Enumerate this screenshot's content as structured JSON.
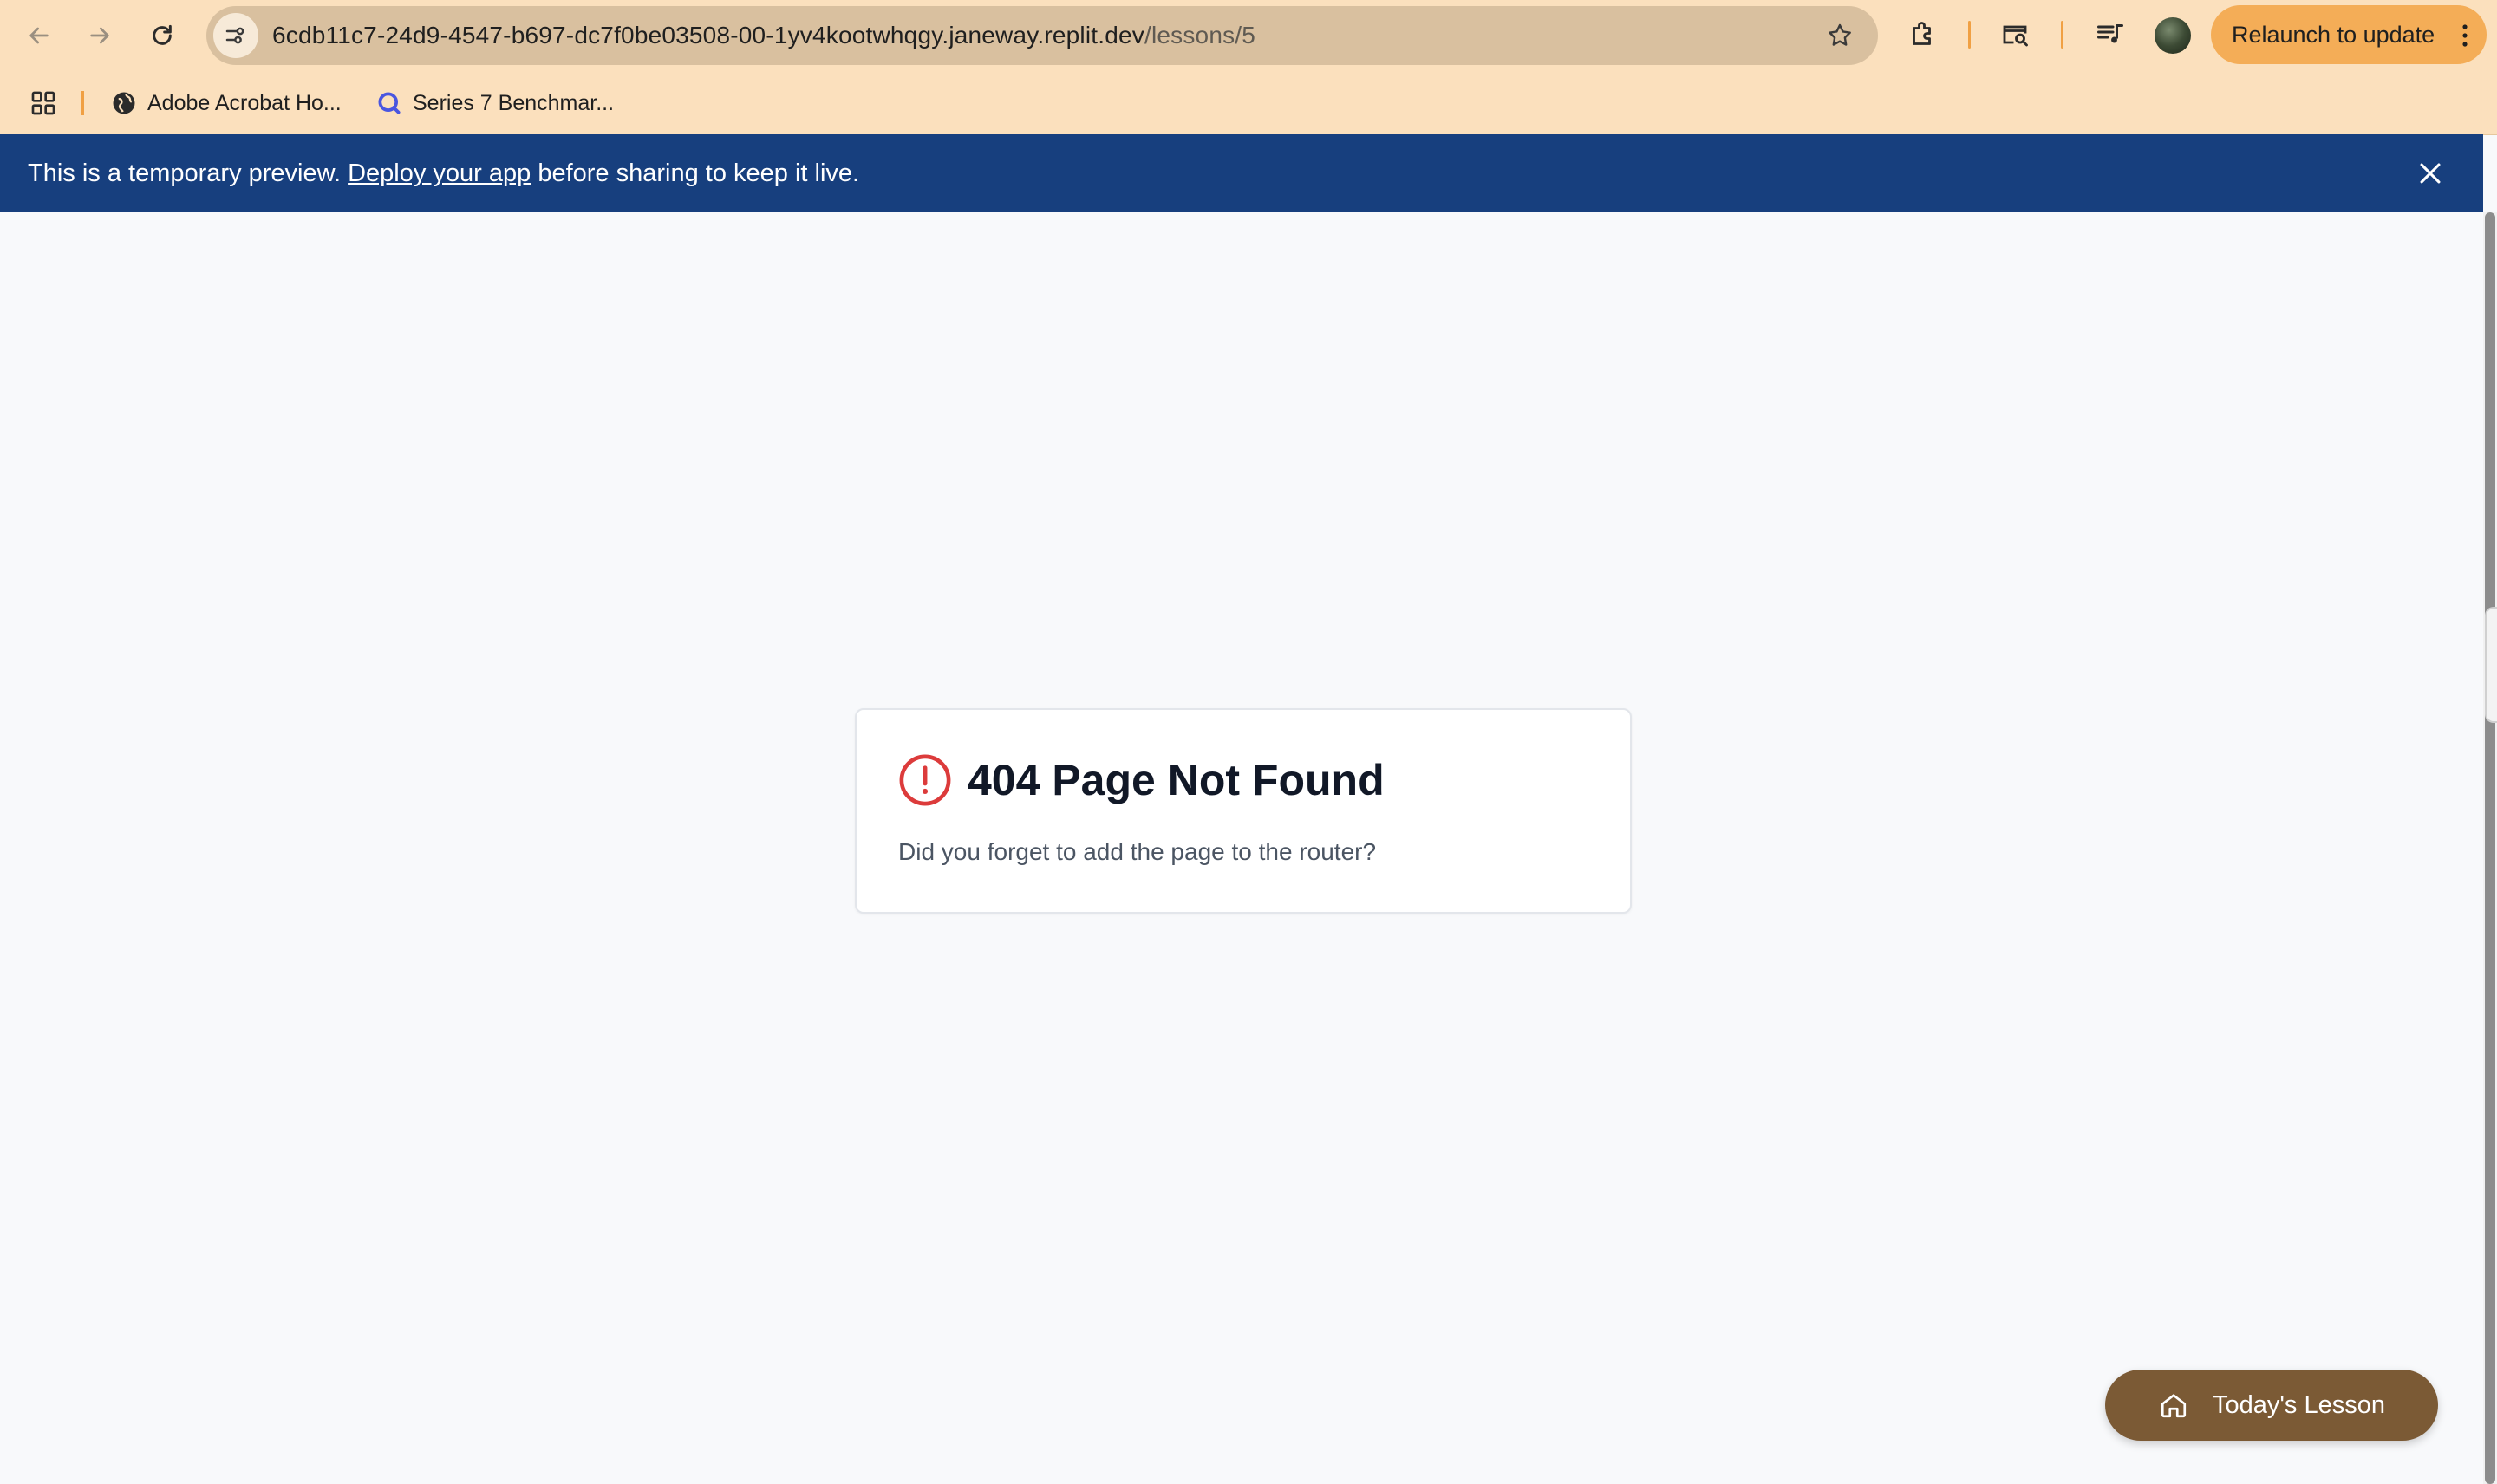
{
  "browser": {
    "url_host": "6cdb11c7-24d9-4547-b697-dc7f0be03508-00-1yv4kootwhqgy.janeway.replit.dev",
    "url_path": "/lessons/5",
    "relaunch_label": "Relaunch to update",
    "bookmarks": [
      {
        "label": "Adobe Acrobat Ho...",
        "icon": "globe-icon"
      },
      {
        "label": "Series 7 Benchmar...",
        "icon": "search-q-icon"
      }
    ]
  },
  "banner": {
    "text_before": "This is a temporary preview. ",
    "link_text": "Deploy your app",
    "text_after": " before sharing to keep it live."
  },
  "not_found": {
    "title": "404 Page Not Found",
    "description": "Did you forget to add the page to the router?"
  },
  "fab": {
    "label": "Today's Lesson",
    "icon": "home-icon"
  },
  "colors": {
    "chrome_bg": "#fbe0bd",
    "banner_bg": "#173f7e",
    "alert_red": "#dc3b3b",
    "fab_bg": "#7b5a35",
    "relaunch_bg": "#f4ad57"
  }
}
